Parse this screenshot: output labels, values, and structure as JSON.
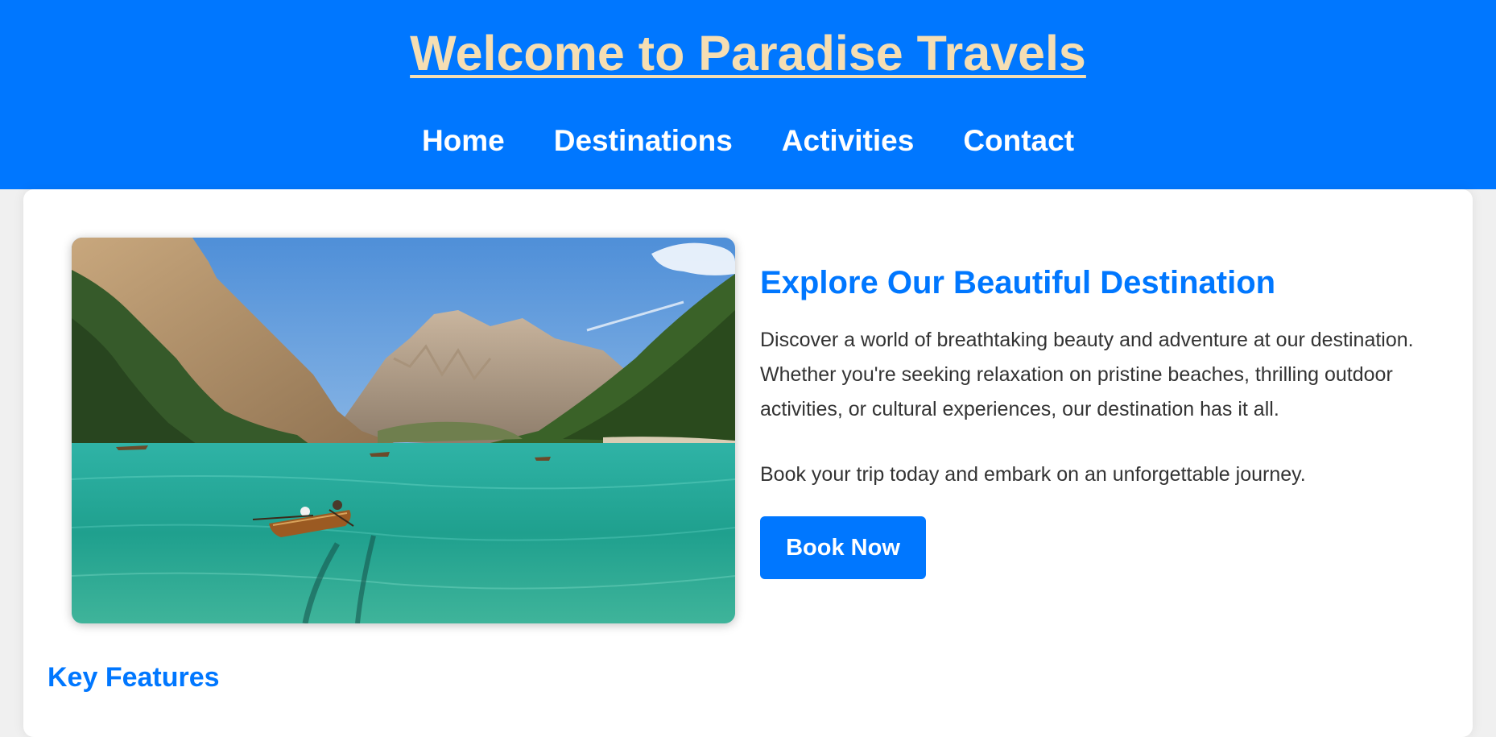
{
  "header": {
    "title": "Welcome to Paradise Travels",
    "nav": [
      {
        "label": "Home"
      },
      {
        "label": "Destinations"
      },
      {
        "label": "Activities"
      },
      {
        "label": "Contact"
      }
    ]
  },
  "main": {
    "hero_image": {
      "icon": "lake-mountains-photo"
    },
    "heading": "Explore Our Beautiful Destination",
    "paragraph_1": "Discover a world of breathtaking beauty and adventure at our destination. Whether you're seeking relaxation on pristine beaches, thrilling outdoor activities, or cultural experiences, our destination has it all.",
    "paragraph_2": "Book your trip today and embark on an unforgettable journey.",
    "book_button": "Book Now",
    "features_heading": "Key Features"
  },
  "colors": {
    "brand_blue": "#0077ff",
    "title_wheat": "#f5deb3",
    "body_text": "#333333",
    "page_bg": "#f0f0f0"
  }
}
